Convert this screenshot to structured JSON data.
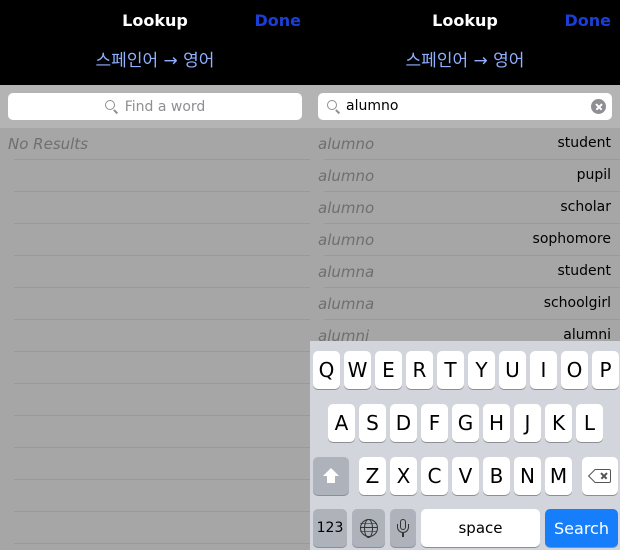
{
  "left_pane": {
    "nav": {
      "title": "Lookup",
      "done_label": "Done",
      "subtitle": "스페인어 → 영어"
    },
    "search": {
      "placeholder": "Find a word",
      "value": ""
    },
    "results": {
      "empty_message": "No Results"
    }
  },
  "right_pane": {
    "nav": {
      "title": "Lookup",
      "done_label": "Done",
      "subtitle": "스페인어 → 영어"
    },
    "search": {
      "placeholder": "",
      "value": "alumno"
    },
    "results": [
      {
        "term": "alumno",
        "translation": "student"
      },
      {
        "term": "alumno",
        "translation": "pupil"
      },
      {
        "term": "alumno",
        "translation": "scholar"
      },
      {
        "term": "alumno",
        "translation": "sophomore"
      },
      {
        "term": "alumna",
        "translation": "student"
      },
      {
        "term": "alumna",
        "translation": "schoolgirl"
      },
      {
        "term": "alumni",
        "translation": "alumni"
      }
    ],
    "keyboard": {
      "row1": [
        "Q",
        "W",
        "E",
        "R",
        "T",
        "Y",
        "U",
        "I",
        "O",
        "P"
      ],
      "row2": [
        "A",
        "S",
        "D",
        "F",
        "G",
        "H",
        "J",
        "K",
        "L"
      ],
      "row3": [
        "Z",
        "X",
        "C",
        "V",
        "B",
        "N",
        "M"
      ],
      "numbers_label": "123",
      "space_label": "space",
      "search_label": "Search",
      "icons": {
        "shift": "shift-icon",
        "delete": "delete-icon",
        "globe": "globe-icon",
        "mic": "mic-icon"
      }
    }
  },
  "colors": {
    "done": "#1b3fd6",
    "subtitle": "#8fb0ff",
    "search_key": "#167efb",
    "list_background": "#a6a6a6"
  }
}
